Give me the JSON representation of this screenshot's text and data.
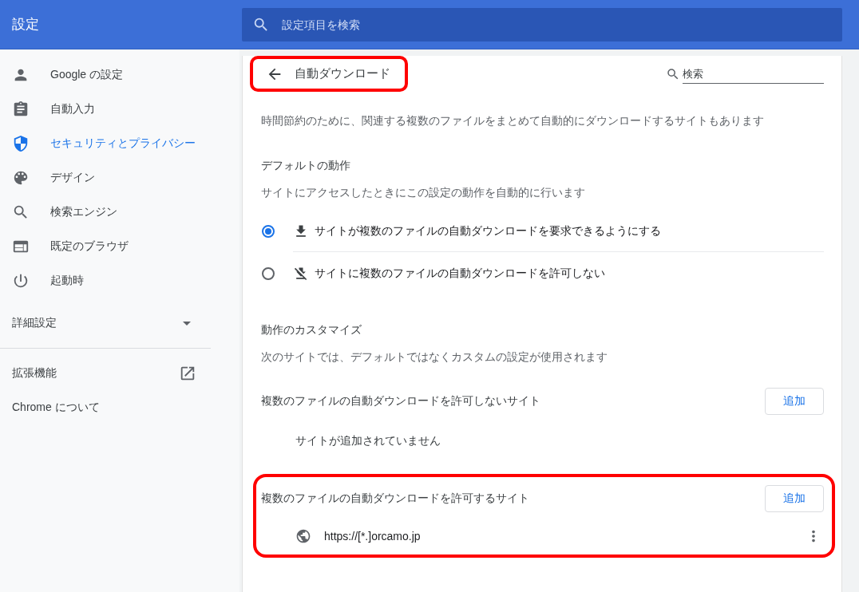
{
  "header": {
    "title": "設定",
    "search": {
      "placeholder": "設定項目を検索"
    }
  },
  "sidebar": {
    "items": [
      {
        "kind": "person",
        "label": "Google の設定",
        "selected": false
      },
      {
        "kind": "clipboard",
        "label": "自動入力",
        "selected": false
      },
      {
        "kind": "shield",
        "label": "セキュリティとプライバシー",
        "selected": true
      },
      {
        "kind": "palette",
        "label": "デザイン",
        "selected": false
      },
      {
        "kind": "search",
        "label": "検索エンジン",
        "selected": false
      },
      {
        "kind": "browser",
        "label": "既定のブラウザ",
        "selected": false
      },
      {
        "kind": "power",
        "label": "起動時",
        "selected": false
      }
    ],
    "advanced": {
      "label": "詳細設定",
      "expanded": false
    },
    "links": [
      {
        "label": "拡張機能",
        "external": true
      },
      {
        "label": "Chrome について",
        "external": false
      }
    ]
  },
  "page": {
    "title": "自動ダウンロード",
    "highlighted": true,
    "search": {
      "placeholder": "検索"
    },
    "description": "時間節約のために、関連する複数のファイルをまとめて自動的にダウンロードするサイトもあります",
    "default_section": {
      "heading": "デフォルトの動作",
      "subtitle": "サイトにアクセスしたときにこの設定の動作を自動的に行います",
      "options": [
        {
          "kind": "download",
          "label": "サイトが複数のファイルの自動ダウンロードを要求できるようにする",
          "selected": true
        },
        {
          "kind": "download-off",
          "label": "サイトに複数のファイルの自動ダウンロードを許可しない",
          "selected": false
        }
      ]
    },
    "custom_section": {
      "heading": "動作のカスタマイズ",
      "subtitle": "次のサイトでは、デフォルトではなくカスタムの設定が使用されます",
      "lists": [
        {
          "title": "複数のファイルの自動ダウンロードを許可しないサイト",
          "add_button": "追加",
          "highlighted": false,
          "empty_text": "サイトが追加されていません"
        },
        {
          "title": "複数のファイルの自動ダウンロードを許可するサイト",
          "add_button": "追加",
          "highlighted": true,
          "sites": [
            {
              "url": "https://[*.]orcamo.jp"
            }
          ]
        }
      ]
    }
  }
}
